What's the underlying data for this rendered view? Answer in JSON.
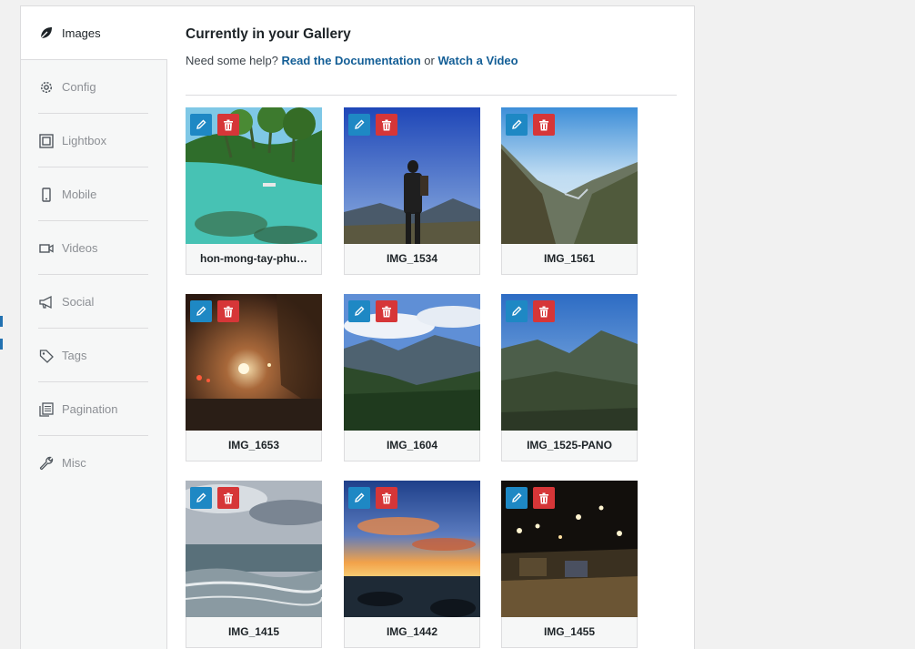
{
  "sidebar": {
    "tabs": [
      {
        "label": "Images",
        "icon": "leaf-icon",
        "active": true
      },
      {
        "label": "Config",
        "icon": "gear-icon",
        "active": false
      },
      {
        "label": "Lightbox",
        "icon": "lightbox-icon",
        "active": false
      },
      {
        "label": "Mobile",
        "icon": "mobile-icon",
        "active": false
      },
      {
        "label": "Videos",
        "icon": "video-icon",
        "active": false
      },
      {
        "label": "Social",
        "icon": "megaphone-icon",
        "active": false
      },
      {
        "label": "Tags",
        "icon": "tag-icon",
        "active": false
      },
      {
        "label": "Pagination",
        "icon": "pagination-icon",
        "active": false
      },
      {
        "label": "Misc",
        "icon": "wrench-icon",
        "active": false
      }
    ]
  },
  "main": {
    "title": "Currently in your Gallery",
    "help_prefix": "Need some help?",
    "doc_link": "Read the Documentation",
    "help_or": "or",
    "video_link": "Watch a Video"
  },
  "gallery": [
    {
      "name": "hon-mong-tay-phu…",
      "scene": "beach"
    },
    {
      "name": "IMG_1534",
      "scene": "person"
    },
    {
      "name": "IMG_1561",
      "scene": "valley"
    },
    {
      "name": "IMG_1653",
      "scene": "night-street"
    },
    {
      "name": "IMG_1604",
      "scene": "forest"
    },
    {
      "name": "IMG_1525-PANO",
      "scene": "mountain"
    },
    {
      "name": "IMG_1415",
      "scene": "sea"
    },
    {
      "name": "IMG_1442",
      "scene": "sunset"
    },
    {
      "name": "IMG_1455",
      "scene": "night-lights"
    }
  ],
  "colors": {
    "edit_button": "#1e88c4",
    "delete_button": "#d63638",
    "link": "#135e96"
  }
}
